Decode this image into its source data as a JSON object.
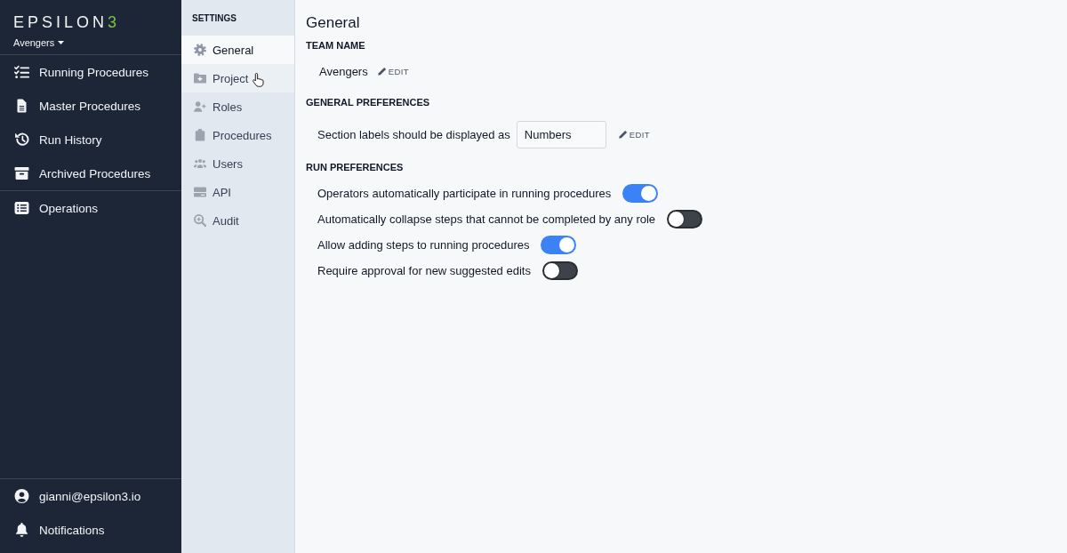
{
  "sidebar": {
    "logo": {
      "text": "EPSILON",
      "accent": "3"
    },
    "team": "Avengers",
    "nav_groups": [
      [
        "Running Procedures",
        "Master Procedures",
        "Run History",
        "Archived Procedures"
      ],
      [
        "Operations"
      ]
    ],
    "footer_items": [
      "gianni@epsilon3.io",
      "Notifications"
    ]
  },
  "settings_nav": {
    "heading": "SETTINGS",
    "items": [
      {
        "label": "General",
        "selected": true,
        "hovered": false
      },
      {
        "label": "Project",
        "selected": false,
        "hovered": true
      },
      {
        "label": "Roles",
        "selected": false,
        "hovered": false
      },
      {
        "label": "Procedures",
        "selected": false,
        "hovered": false
      },
      {
        "label": "Users",
        "selected": false,
        "hovered": false
      },
      {
        "label": "API",
        "selected": false,
        "hovered": false
      },
      {
        "label": "Audit",
        "selected": false,
        "hovered": false
      }
    ]
  },
  "main": {
    "title": "General",
    "sections": [
      {
        "kind": "text",
        "heading": "TEAM NAME",
        "value": "Avengers",
        "action": "EDIT"
      },
      {
        "kind": "field",
        "heading": "GENERAL PREFERENCES",
        "label": "Section labels should be displayed as",
        "value": "Numbers",
        "action": "EDIT"
      },
      {
        "kind": "toggles",
        "heading": "RUN PREFERENCES",
        "toggles": [
          {
            "label": "Operators automatically participate in running procedures",
            "on": true
          },
          {
            "label": "Automatically collapse steps that cannot be completed by any role",
            "on": false
          },
          {
            "label": "Allow adding steps to running procedures",
            "on": true
          },
          {
            "label": "Require approval for new suggested edits",
            "on": false
          }
        ]
      }
    ]
  }
}
